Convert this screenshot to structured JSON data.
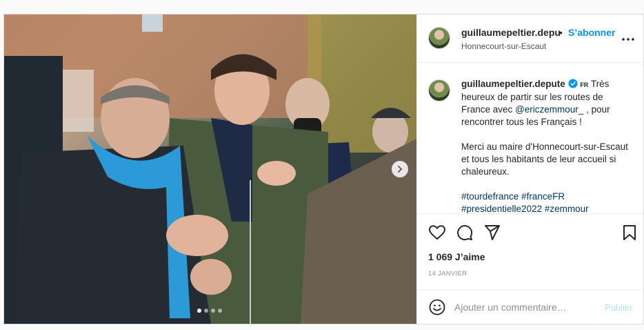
{
  "header": {
    "username": "guillaumepeltier.depu",
    "separator": "•",
    "follow_label": "S’abonner",
    "location": "Honnecourt-sur-Escaut"
  },
  "caption": {
    "username": "guillaumepeltier.depute",
    "flag_text": "FR",
    "line1": "Très heureux de partir sur les routes de France avec",
    "mention": "@ericzemmour_",
    "line1_end": ", pour rencontrer tous les Français !",
    "paragraph2": "Merci au maire d'Honnecourt-sur-Escaut et tous les habitants de leur accueil si chaleureux.",
    "hashtags": "#tourdefrance #franceFR #presidentielle2022 #zemmour"
  },
  "stats": {
    "likes": "1 069 J’aime",
    "date": "14 JANVIER"
  },
  "comment": {
    "placeholder": "Ajouter un commentaire…",
    "publish_label": "Publier"
  },
  "carousel": {
    "slide_count": 4,
    "active_index": 0
  },
  "icons": {
    "verified": "verified-badge-icon",
    "more": "more-options-icon",
    "like": "heart-icon",
    "comment": "comment-icon",
    "share": "share-icon",
    "save": "bookmark-icon",
    "emoji": "emoji-icon",
    "next": "chevron-right-icon"
  },
  "colors": {
    "accent": "#0095f6",
    "link": "#00376b",
    "verified": "#0095f6",
    "publish_disabled": "#b2dffc"
  }
}
